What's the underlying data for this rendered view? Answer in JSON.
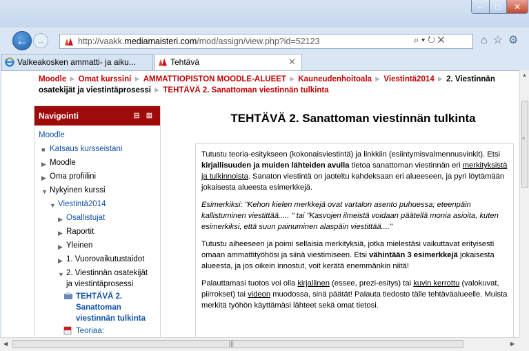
{
  "window": {
    "controls": {
      "minimize": "–",
      "maximize": "□",
      "close": "✕"
    }
  },
  "browser": {
    "url_prefix": "http://vaakk.",
    "url_domain": "mediamaisteri.com",
    "url_suffix": "/mod/assign/view.php?id=52123",
    "addr_tools": "⌕ ▾ ↻ ✕",
    "toolbar_icons": "⌂☆⚙",
    "tabs": [
      {
        "label": "Valkeakosken ammatti- ja aiku...",
        "icon": "ie-icon"
      },
      {
        "label": "Tehtävä",
        "icon": "moodle-icon",
        "close": "✕"
      }
    ]
  },
  "breadcrumb": {
    "items": [
      "Moodle",
      "Omat kurssini",
      "AMMATTIOPISTON MOODLE-ALUEET",
      "Kauneudenhoitoala",
      "Viestintä2014"
    ],
    "current": "2. Viestinnän osatekijät ja viestintäprosessi",
    "last": "TEHTÄVÄ 2. Sanattoman viestinnän tulkinta",
    "separator": "►"
  },
  "navigation": {
    "title": "Navigointi",
    "header_icons": "⊟ ⊠",
    "items": [
      {
        "label": "Moodle",
        "type": "link"
      },
      {
        "label": "Katsaus kursseistani",
        "type": "link"
      },
      {
        "label": "Moodle",
        "type": "text"
      },
      {
        "label": "Oma profiilini",
        "type": "text"
      },
      {
        "label": "Nykyinen kurssi",
        "type": "text"
      },
      {
        "label": "Viestintä2014",
        "type": "link"
      },
      {
        "label": "Osallistujat",
        "type": "link"
      },
      {
        "label": "Raportit",
        "type": "text"
      },
      {
        "label": "Yleinen",
        "type": "text"
      },
      {
        "label": "1. Vuorovaikutustaidot",
        "type": "text"
      },
      {
        "label": "2. Viestinnän osatekijät ja viestintäprosessi",
        "type": "text"
      },
      {
        "label": "TEHTÄVÄ 2. Sanattoman viestinnän tulkinta",
        "type": "current"
      },
      {
        "label": "Teoriaa:",
        "type": "link"
      }
    ]
  },
  "main": {
    "title": "TEHTÄVÄ 2. Sanattoman viestinnän tulkinta",
    "p1_a": "Tutustu teoria-esitykseen (kokonaisviestintä) ja linkkiin (esiintymisvalmennusvinkit). Etsi ",
    "p1_b": "kirjallisuuden ja muiden lähteiden avulla",
    "p1_c": " tietoa sanattoman viestinnän eri ",
    "p1_d": "merkityksistä ja tulkinnoista",
    "p1_e": ". Sanaton viestintä on jaoteltu kahdeksaan eri alueeseen, ja pyri löytämään jokaisesta alueesta esimerkkejä.",
    "p2": "Esimerkiksi: \"Kehon kielen merkkejä ovat vartalon asento puhuessa; eteenpäin kallistuminen viestittää..... \" tai \"Kasvojen ilmeistä voidaan päätellä monia asioita, kuten esimerkiksi, että suun painuminen alaspäin viestittää....\"",
    "p3_a": "Tutustu aiheeseen ja poimi sellaisia merkityksiä, jotka mielestäsi vaikuttavat erityisesti omaan ammattityöhösi ja siinä viestimiseen. Etsi ",
    "p3_b": "vähintään 3 esimerkkejä",
    "p3_c": " jokaisesta alueesta, ja jos oikein innostut, voit kerätä enemmänkin niitä!",
    "p4_a": "Palauttamasi tuotos voi olla ",
    "p4_b": "kirjallinen",
    "p4_c": " (essee, prezi-esitys) tai ",
    "p4_d": "kuvin kerrottu",
    "p4_e": " (valokuvat, piirrokset) tai ",
    "p4_f": "videon",
    "p4_g": " muodossa, sinä päätät! Palauta tiedosto tälle tehtäväalueelle. Muista merkitä työhön käyttämäsi lähteet sekä omat tietosi."
  },
  "colors": {
    "accent": "#9e0b0b",
    "link": "#0f52a8",
    "breadcrumb": "#c00000"
  }
}
